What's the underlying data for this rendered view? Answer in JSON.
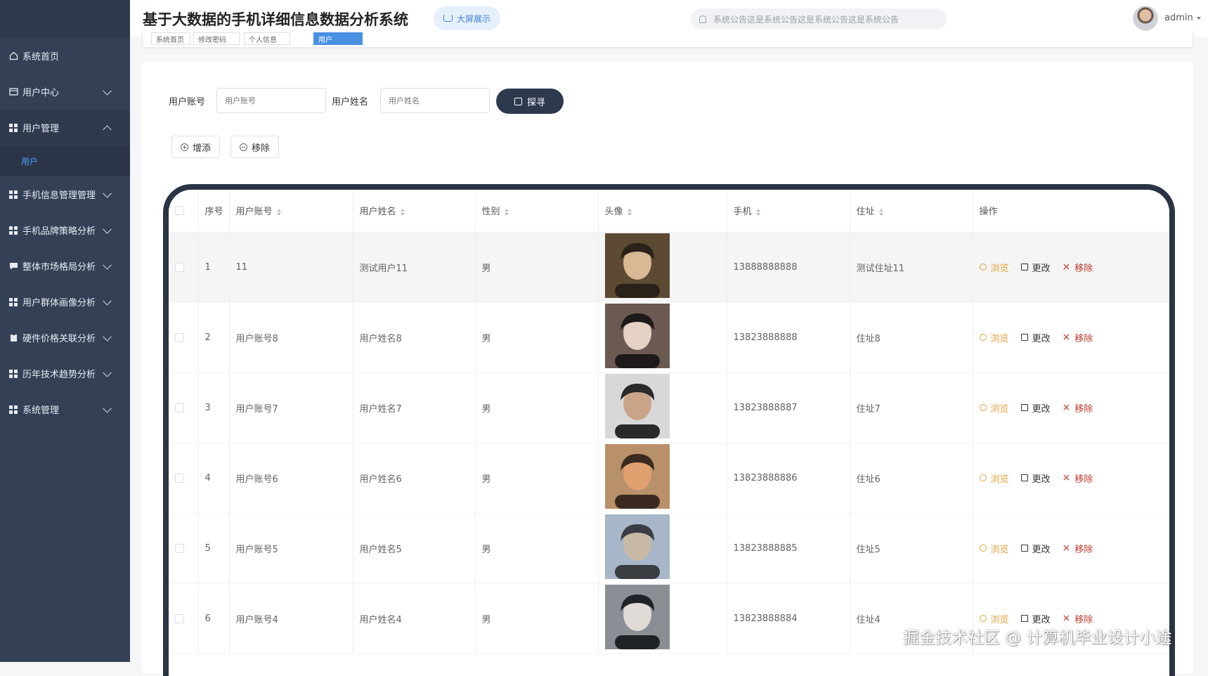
{
  "header": {
    "title": "基于大数据的手机详细信息数据分析系统",
    "bigscreen_label": "大屏展示",
    "notice": "系统公告这是系统公告这是系统公告这是系统公告",
    "username": "admin"
  },
  "tabs": [
    "系统首页",
    "修改密码",
    "个人信息",
    "用户"
  ],
  "sidebar": {
    "items": [
      {
        "label": "系统首页",
        "icon": "home-icon",
        "chevron": false
      },
      {
        "label": "用户中心",
        "icon": "card-icon",
        "chevron": true
      },
      {
        "label": "用户管理",
        "icon": "grid-icon",
        "chevron": true,
        "open": true
      },
      {
        "label": "手机信息管理管理",
        "icon": "grid-icon",
        "chevron": true
      },
      {
        "label": "手机品牌策略分析",
        "icon": "grid-icon",
        "chevron": true
      },
      {
        "label": "整体市场格局分析",
        "icon": "chat-icon",
        "chevron": true
      },
      {
        "label": "用户群体画像分析",
        "icon": "grid-icon",
        "chevron": true
      },
      {
        "label": "硬件价格关联分析",
        "icon": "clipboard-icon",
        "chevron": true
      },
      {
        "label": "历年技术趋势分析",
        "icon": "grid-icon",
        "chevron": true
      },
      {
        "label": "系统管理",
        "icon": "grid-icon",
        "chevron": true
      }
    ],
    "sub_item": "用户"
  },
  "search": {
    "account_label": "用户账号",
    "account_placeholder": "用户账号",
    "name_label": "用户姓名",
    "name_placeholder": "用户姓名",
    "button": "探寻"
  },
  "actions": {
    "add": "增添",
    "remove": "移除"
  },
  "table": {
    "headers": [
      "序号",
      "用户账号",
      "用户姓名",
      "性别",
      "头像",
      "手机",
      "住址",
      "操作"
    ],
    "rows": [
      {
        "no": "1",
        "account": "11",
        "name": "测试用户11",
        "gender": "男",
        "phone": "13888888888",
        "address": "测试住址11"
      },
      {
        "no": "2",
        "account": "用户账号8",
        "name": "用户姓名8",
        "gender": "男",
        "phone": "13823888888",
        "address": "住址8"
      },
      {
        "no": "3",
        "account": "用户账号7",
        "name": "用户姓名7",
        "gender": "男",
        "phone": "13823888887",
        "address": "住址7"
      },
      {
        "no": "4",
        "account": "用户账号6",
        "name": "用户姓名6",
        "gender": "男",
        "phone": "13823888886",
        "address": "住址6"
      },
      {
        "no": "5",
        "account": "用户账号5",
        "name": "用户姓名5",
        "gender": "男",
        "phone": "13823888885",
        "address": "住址5"
      },
      {
        "no": "6",
        "account": "用户账号4",
        "name": "用户姓名4",
        "gender": "男",
        "phone": "13823888884",
        "address": "住址4"
      }
    ],
    "ops": {
      "view": "浏览",
      "edit": "更改",
      "delete": "移除"
    }
  },
  "watermark": "掘金技术社区 @ 计算机毕业设计小途"
}
